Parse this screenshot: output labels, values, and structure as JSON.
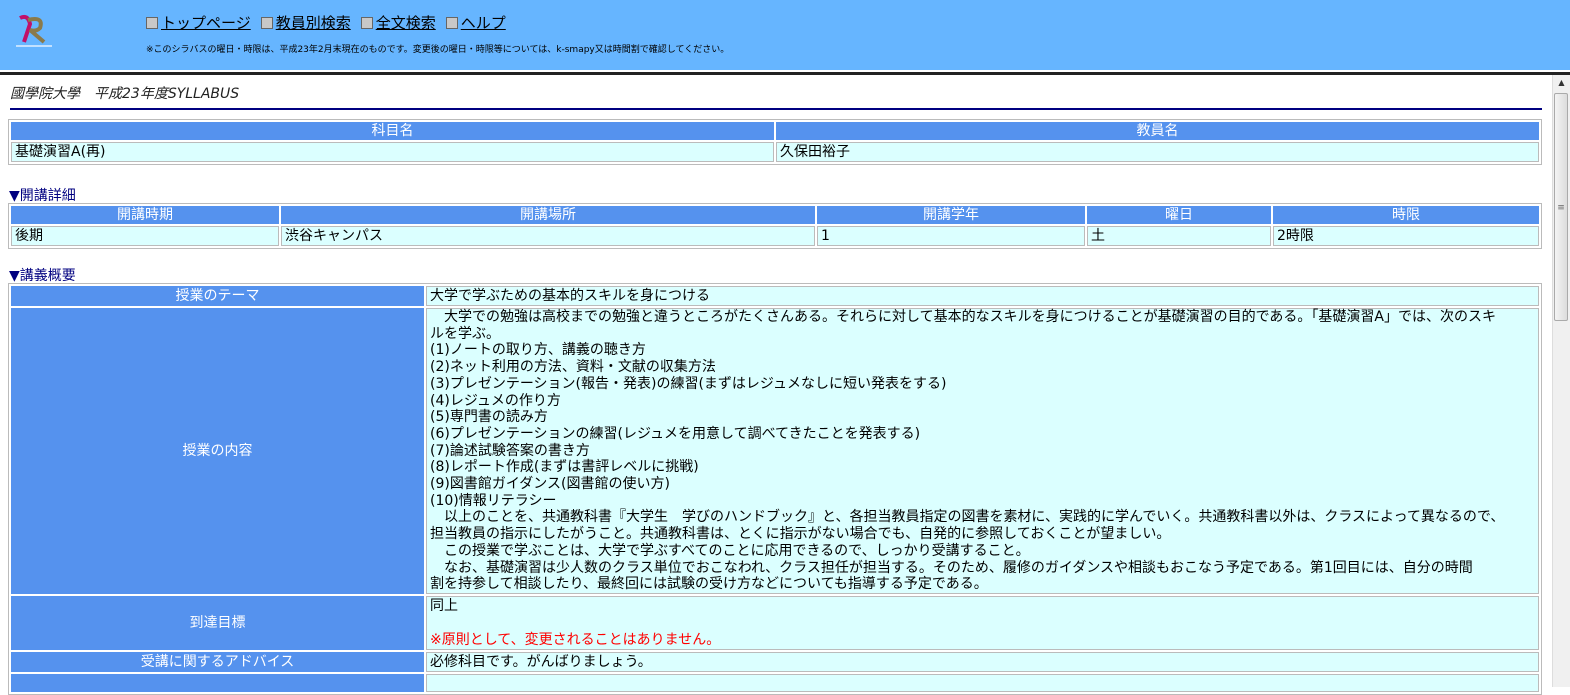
{
  "header": {
    "logo_text": "KOKUGAKUIN",
    "nav": [
      "トップページ",
      "教員別検索",
      "全文検索",
      "ヘルプ"
    ],
    "note": "※このシラバスの曜日・時限は、平成23年2月末現在のものです。変更後の曜日・時限等については、k-smapy又は時間割で確認してください。"
  },
  "page_title": "國學院大學　平成23年度SYLLABUS",
  "course": {
    "headers": [
      "科目名",
      "教員名"
    ],
    "values": [
      "基礎演習A(再)",
      "久保田裕子"
    ]
  },
  "details": {
    "section": "▼開講詳細",
    "headers": [
      "開講時期",
      "開講場所",
      "開講学年",
      "曜日",
      "時限"
    ],
    "values": [
      "後期",
      "渋谷キャンパス",
      "1",
      "土",
      "2時限"
    ]
  },
  "overview": {
    "section": "▼講義概要",
    "theme_label": "授業のテーマ",
    "theme": "大学で学ぶための基本的スキルを身につける",
    "content_label": "授業の内容",
    "content_lines": [
      "　大学での勉強は高校までの勉強と違うところがたくさんある。それらに対して基本的なスキルを身につけることが基礎演習の目的である。「基礎演習A」では、次のスキ",
      "ルを学ぶ。",
      "(1)ノートの取り方、講義の聴き方",
      "(2)ネット利用の方法、資料・文献の収集方法",
      "(3)プレゼンテーション(報告・発表)の練習(まずはレジュメなしに短い発表をする)",
      "(4)レジュメの作り方",
      "(5)専門書の読み方",
      "(6)プレゼンテーションの練習(レジュメを用意して調べてきたことを発表する)",
      "(7)論述試験答案の書き方",
      "(8)レポート作成(まずは書評レベルに挑戦)",
      "(9)図書館ガイダンス(図書館の使い方)",
      "(10)情報リテラシー",
      "　以上のことを、共通教科書『大学生　学びのハンドブック』と、各担当教員指定の図書を素材に、実践的に学んでいく。共通教科書以外は、クラスによって異なるので、",
      "担当教員の指示にしたがうこと。共通教科書は、とくに指示がない場合でも、自発的に参照しておくことが望ましい。",
      "　この授業で学ぶことは、大学で学ぶすべてのことに応用できるので、しっかり受講すること。",
      "　なお、基礎演習は少人数のクラス単位でおこなわれ、クラス担任が担当する。そのため、履修のガイダンスや相談もおこなう予定である。第1回目には、自分の時間",
      "割を持参して相談したり、最終回には試験の受け方などについても指導する予定である。"
    ],
    "goal_label": "到達目標",
    "goal": "同上",
    "goal_note": "※原則として、変更されることはありません。",
    "advice_label": "受講に関するアドバイス",
    "advice": "必修科目です。がんばりましょう。"
  },
  "colors": {
    "header_bg": "#66b5ff",
    "cell_header": "#5592ee",
    "cell_data": "#dbffff"
  }
}
